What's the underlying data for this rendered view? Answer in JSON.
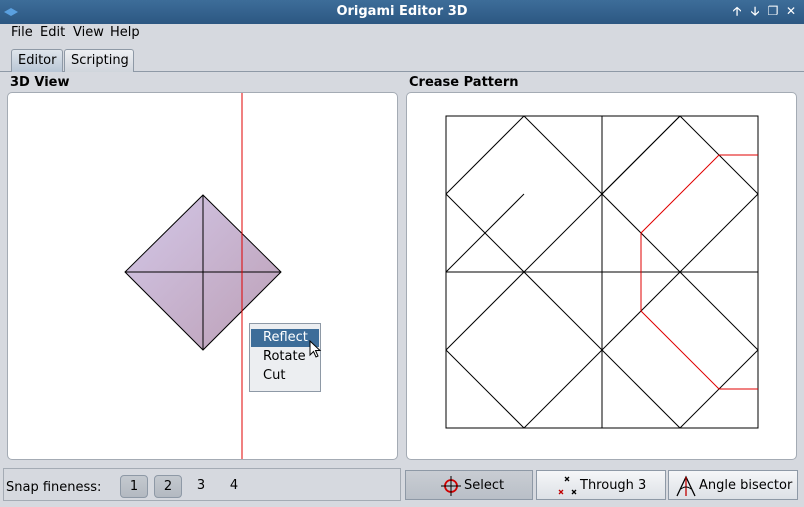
{
  "window": {
    "title": "Origami Editor 3D",
    "controls": [
      "🡡",
      "🡣",
      "❐",
      "✕"
    ]
  },
  "menu": [
    "File",
    "Edit",
    "View",
    "Help"
  ],
  "tabs": [
    {
      "label": "Editor",
      "active": true
    },
    {
      "label": "Scripting",
      "active": false
    }
  ],
  "panels": {
    "view3d_title": "3D View",
    "crease_title": "Crease Pattern"
  },
  "context_menu": {
    "items": [
      "Reflect",
      "Rotate",
      "Cut"
    ],
    "highlighted": "Reflect"
  },
  "snap": {
    "label": "Snap fineness:",
    "options": [
      "1",
      "2",
      "3",
      "4"
    ],
    "pressed": [
      "1",
      "2"
    ]
  },
  "tools": [
    {
      "label": "Select",
      "icon": "crosshair-icon",
      "active": true
    },
    {
      "label": "Through 3",
      "icon": "through-three-points-icon",
      "active": false
    },
    {
      "label": "Angle bisector",
      "icon": "angle-bisector-icon",
      "active": false
    }
  ],
  "colors": {
    "titlebar": "#2c5782",
    "crease_line": "#000000",
    "cut_line": "#e00000",
    "paper_fill": "#c9b4d6"
  }
}
